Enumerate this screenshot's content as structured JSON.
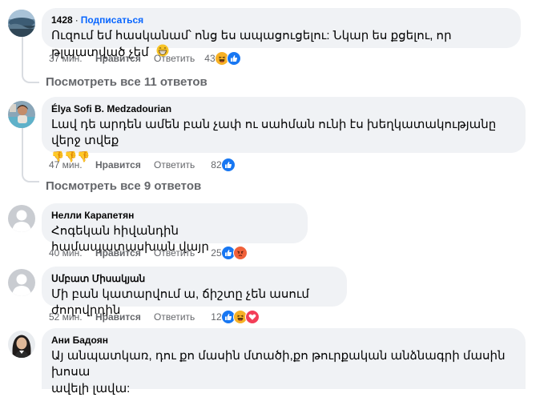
{
  "comments": [
    {
      "author": "1428",
      "follow": "Подписаться",
      "text": "Ուզում եմ հասկանամ՝ ոնց ես ապացուցելու: Նկար ես քցելու, որ թլպատված չեմ",
      "time": "37 мин.",
      "like": "Нравится",
      "reply": "Ответить",
      "count": "43",
      "reactions": [
        "haha",
        "like"
      ]
    },
    {
      "author": "Élya Sofi B. Medzadourian",
      "text": "Լավ դե արդեն ամեն բան չափ ու սահման ունի էս խեղկատակությանը վերջ տվեք",
      "emoji_line": "👎👎👎",
      "time": "47 мин.",
      "like": "Нравится",
      "reply": "Ответить",
      "count": "82",
      "reactions": [
        "like"
      ]
    },
    {
      "author": "Нелли Карапетян",
      "text": "Հոգեկան հիվանդին համապատասխան վայր",
      "time": "40 мин.",
      "like": "Нравится",
      "reply": "Ответить",
      "count": "25",
      "reactions": [
        "like",
        "angry"
      ]
    },
    {
      "author": "Սմբատ Միսակյան",
      "text": "Մի բան կատարվում ա, ճիշտը չեն ասում ժողովրդին",
      "time": "52 мин.",
      "like": "Нравится",
      "reply": "Ответить",
      "count": "12",
      "reactions": [
        "like",
        "haha",
        "love"
      ]
    },
    {
      "author": "Ани Бадоян",
      "text_line1": "Այ անպատկառ, դու քո մասին մտածի,քո թուրքական անձնագրի մասին խոսա",
      "text_line2": "ավելի լավա:"
    }
  ],
  "view_replies": [
    "Посмотреть все 11 ответов",
    "Посмотреть все 9 ответов"
  ],
  "colors": {
    "bubble": "#f0f2f5",
    "link_blue": "#0866ff",
    "secondary_text": "#65676b",
    "like_blue": "#1877f2",
    "angry_orange": "#f0613a",
    "love_red": "#f33e58",
    "haha_yellow": "#f7b125"
  }
}
